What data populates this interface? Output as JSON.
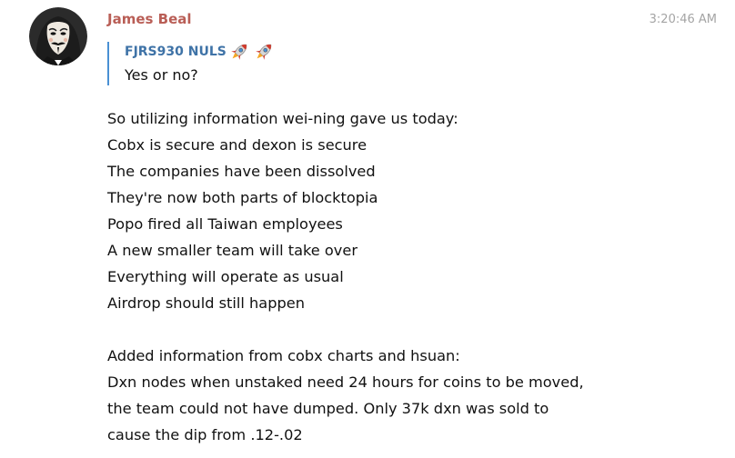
{
  "message": {
    "sender": "James Beal",
    "timestamp": "3:20:46 AM",
    "reply": {
      "author": "FJRS930 NULS",
      "author_emojis": [
        "rocket-icon",
        "rocket-icon"
      ],
      "text": "Yes or no?"
    },
    "lines": [
      "So utilizing information wei-ning gave us today:",
      "Cobx is secure and dexon is secure",
      "The companies have been dissolved",
      "They're now both parts of blocktopia",
      "Popo fired all Taiwan employees",
      "A new smaller team will take over",
      "Everything will operate as usual",
      "Airdrop should still happen",
      "",
      "Added information from cobx charts and hsuan:",
      "Dxn nodes when unstaked need 24 hours for coins to be moved,",
      "the team could not have dumped.  Only 37k dxn was sold to",
      "cause the dip from .12-.02"
    ]
  },
  "colors": {
    "sender": "#b95e56",
    "reply_author": "#3f73a7",
    "reply_bar": "#4a90d4",
    "timestamp": "#a4a4a4",
    "text": "#111111"
  }
}
